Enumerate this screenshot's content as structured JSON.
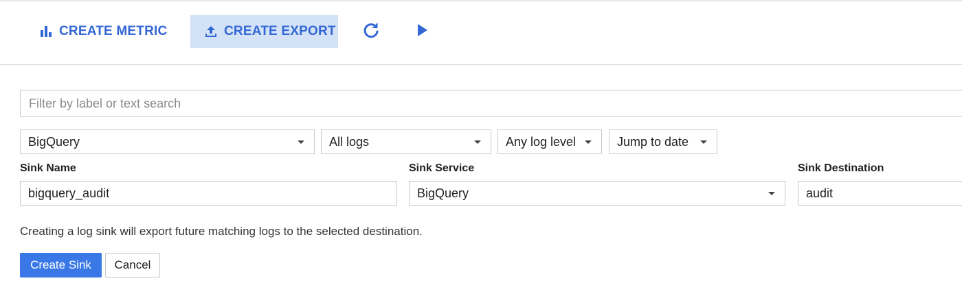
{
  "toolbar": {
    "create_metric_label": "CREATE METRIC",
    "create_metric_icon": "bar-chart-icon",
    "create_export_label": "CREATE EXPORT",
    "create_export_icon": "upload-icon",
    "refresh_icon": "refresh-icon",
    "play_icon": "play-icon",
    "accent_color": "#3367d6",
    "active_bg": "#d4e2f7"
  },
  "filter": {
    "placeholder": "Filter by label or text search",
    "value": ""
  },
  "dropdowns": {
    "resource": "BigQuery",
    "logs": "All logs",
    "log_level": "Any log level",
    "jump_to_date": "Jump to date"
  },
  "sink": {
    "name_label": "Sink Name",
    "name_value": "bigquery_audit",
    "service_label": "Sink Service",
    "service_value": "BigQuery",
    "destination_label": "Sink Destination",
    "destination_value": "audit"
  },
  "info_text": "Creating a log sink will export future matching logs to the selected destination.",
  "actions": {
    "create_label": "Create Sink",
    "cancel_label": "Cancel",
    "primary_color": "#3b78e7"
  }
}
